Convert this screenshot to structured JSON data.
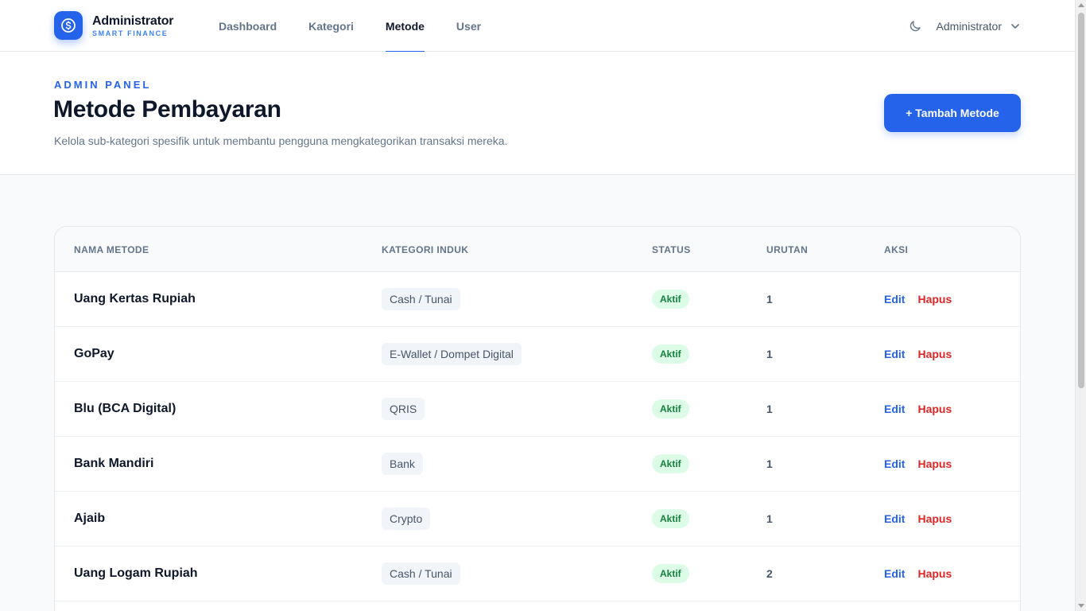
{
  "brand": {
    "name": "Administrator",
    "subtitle": "SMART FINANCE"
  },
  "nav": {
    "links": [
      "Dashboard",
      "Kategori",
      "Metode",
      "User"
    ],
    "active": "Metode",
    "user_name": "Administrator"
  },
  "header": {
    "eyebrow": "ADMIN PANEL",
    "title": "Metode Pembayaran",
    "description": "Kelola sub-kategori spesifik untuk membantu pengguna mengkategorikan transaksi mereka.",
    "add_button": "+ Tambah Metode"
  },
  "table": {
    "columns": [
      "NAMA METODE",
      "KATEGORI INDUK",
      "STATUS",
      "URUTAN",
      "AKSI"
    ],
    "edit_label": "Edit",
    "delete_label": "Hapus",
    "rows": [
      {
        "name": "Uang Kertas Rupiah",
        "category": "Cash / Tunai",
        "status": "Aktif",
        "order": "1"
      },
      {
        "name": "GoPay",
        "category": "E-Wallet / Dompet Digital",
        "status": "Aktif",
        "order": "1"
      },
      {
        "name": "Blu (BCA Digital)",
        "category": "QRIS",
        "status": "Aktif",
        "order": "1"
      },
      {
        "name": "Bank Mandiri",
        "category": "Bank",
        "status": "Aktif",
        "order": "1"
      },
      {
        "name": "Ajaib",
        "category": "Crypto",
        "status": "Aktif",
        "order": "1"
      },
      {
        "name": "Uang Logam Rupiah",
        "category": "Cash / Tunai",
        "status": "Aktif",
        "order": "2"
      }
    ]
  },
  "icons": {
    "logo": "dollar-coin-icon",
    "theme": "moon-icon",
    "user_menu": "chevron-down-icon"
  },
  "colors": {
    "accent": "#2563eb",
    "danger": "#dc2626",
    "success_bg": "#dcfce7",
    "success_text": "#15803d"
  }
}
